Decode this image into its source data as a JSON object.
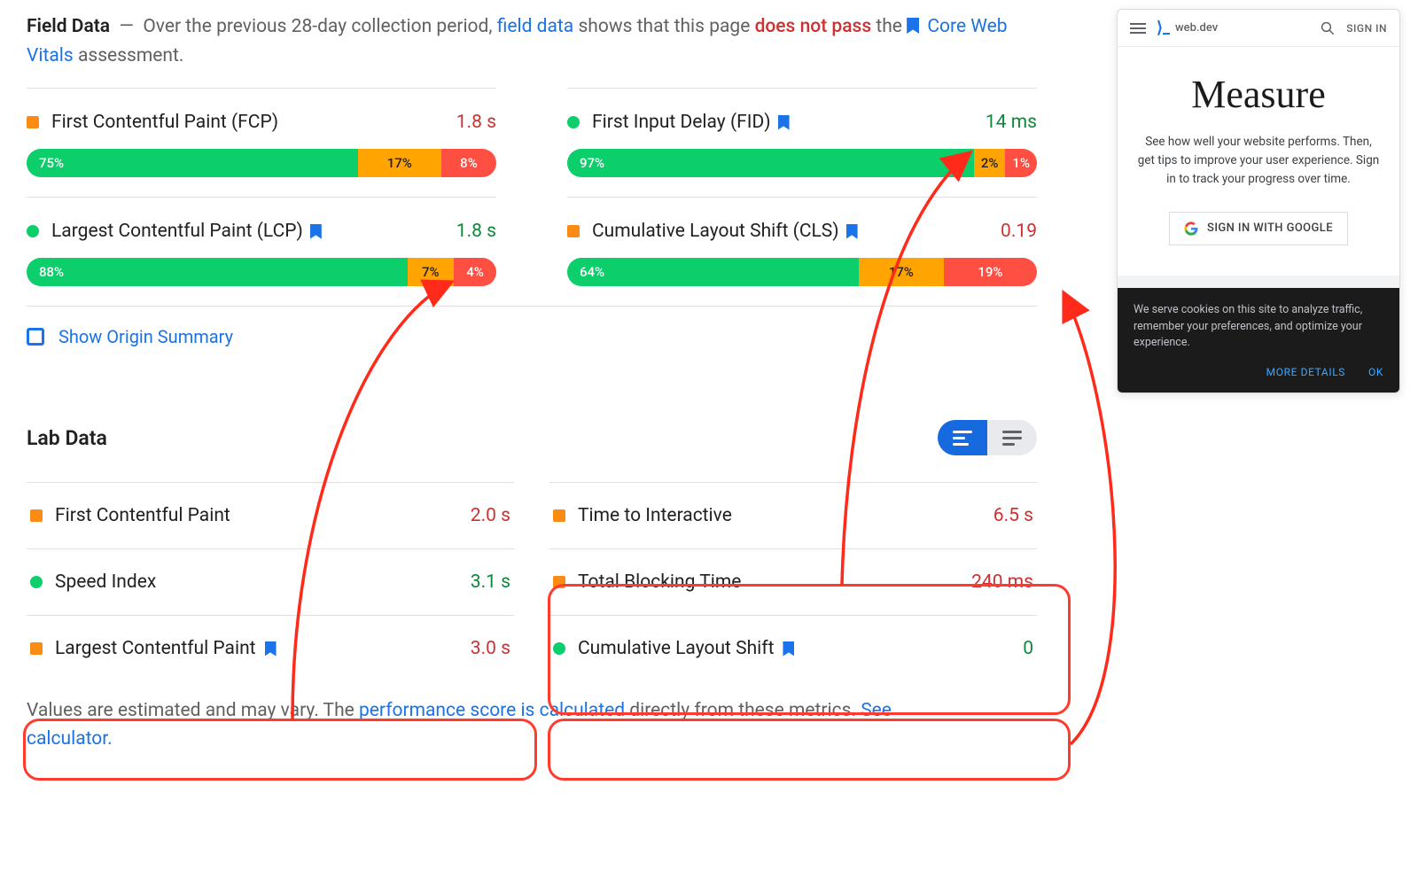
{
  "intro": {
    "title": "Field Data",
    "text1": "Over the previous 28-day collection period,",
    "link_field_data": "field data",
    "text2": "shows that this page",
    "fail": "does not pass",
    "text3": "the",
    "cwv_link": "Core Web Vitals",
    "text4": "assessment."
  },
  "field_metrics": {
    "fcp": {
      "name": "First Contentful Paint (FCP)",
      "value": "1.8 s",
      "good": "75%",
      "mid": "17%",
      "bad": "8%"
    },
    "fid": {
      "name": "First Input Delay (FID)",
      "value": "14 ms",
      "good": "97%",
      "mid": "2%",
      "bad": "1%"
    },
    "lcp": {
      "name": "Largest Contentful Paint (LCP)",
      "value": "1.8 s",
      "good": "88%",
      "mid": "7%",
      "bad": "4%"
    },
    "cls": {
      "name": "Cumulative Layout Shift (CLS)",
      "value": "0.19",
      "good": "64%",
      "mid": "17%",
      "bad": "19%"
    }
  },
  "origin_summary": "Show Origin Summary",
  "lab": {
    "title": "Lab Data",
    "rows": {
      "fcp": {
        "name": "First Contentful Paint",
        "value": "2.0 s"
      },
      "si": {
        "name": "Speed Index",
        "value": "3.1 s"
      },
      "lcp": {
        "name": "Largest Contentful Paint",
        "value": "3.0 s"
      },
      "tti": {
        "name": "Time to Interactive",
        "value": "6.5 s"
      },
      "tbt": {
        "name": "Total Blocking Time",
        "value": "240 ms"
      },
      "cls": {
        "name": "Cumulative Layout Shift",
        "value": "0"
      }
    }
  },
  "footnote": {
    "t1": "Values are estimated and may vary. The",
    "link1": "performance score is calculated",
    "t2": "directly from these metrics.",
    "link2": "See calculator."
  },
  "phone": {
    "brand": "web.dev",
    "signin": "SIGN IN",
    "h1": "Measure",
    "p": "See how well your website performs. Then, get tips to improve your user experience. Sign in to track your progress over time.",
    "btn": "SIGN IN WITH GOOGLE",
    "cookie": "We serve cookies on this site to analyze traffic, remember your preferences, and optimize your experience.",
    "more": "MORE DETAILS",
    "ok": "OK"
  }
}
